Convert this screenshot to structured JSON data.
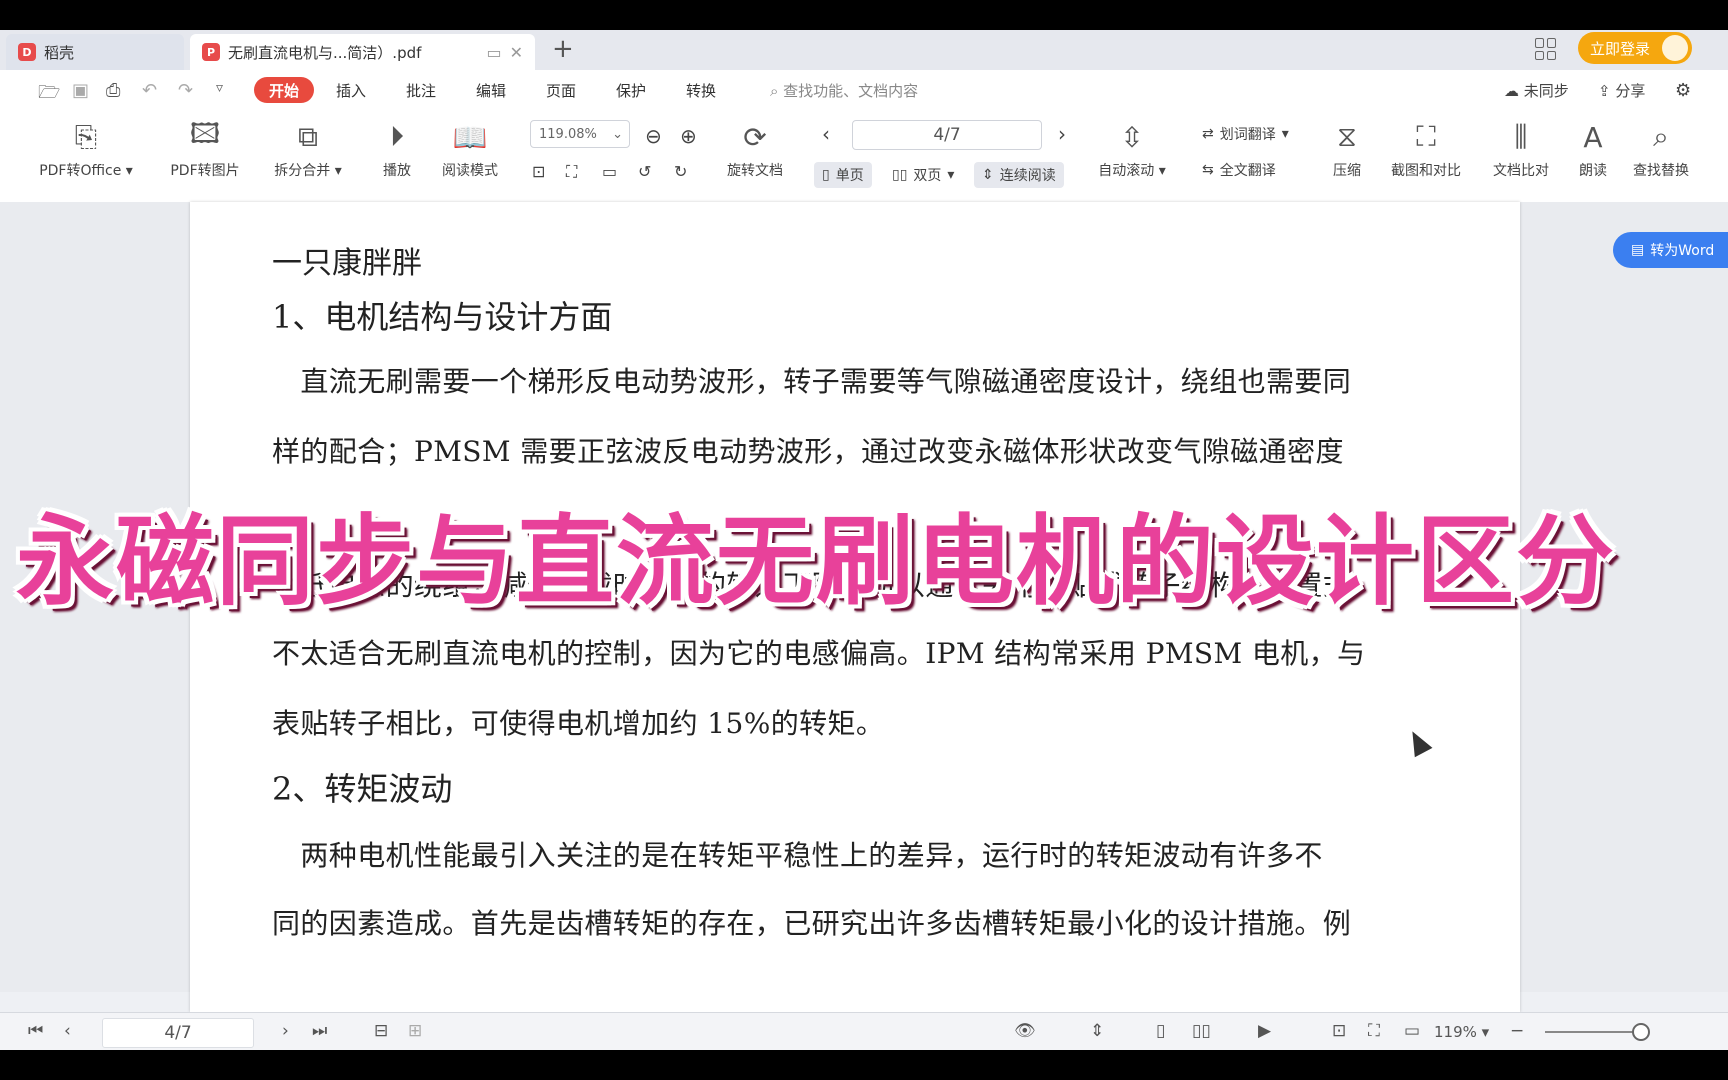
{
  "tabs": [
    {
      "label": "稻壳"
    },
    {
      "label": "无刷直流电机与...简洁）.pdf"
    }
  ],
  "titlebar": {
    "login": "立即登录"
  },
  "menu": {
    "start": "开始",
    "items": [
      "插入",
      "批注",
      "编辑",
      "页面",
      "保护",
      "转换"
    ],
    "search_placeholder": "查找功能、文档内容",
    "sync": "未同步",
    "share": "分享"
  },
  "ribbon": {
    "pdf_office": "PDF转Office",
    "pdf_image": "PDF转图片",
    "split_merge": "拆分合并",
    "play": "播放",
    "read_mode": "阅读模式",
    "zoom": "119.08%",
    "rotate": "旋转文档",
    "page_value": "4/7",
    "single": "单页",
    "double": "双页",
    "continuous": "连续阅读",
    "auto_scroll": "自动滚动",
    "word_translate": "划词翻译",
    "full_translate": "全文翻译",
    "compress": "压缩",
    "screenshot_compare": "截图和对比",
    "doc_compare": "文档比对",
    "read_aloud": "朗读",
    "find_replace": "查找替换"
  },
  "convert_word": "转为Word",
  "document": {
    "author": "一只康胖胖",
    "heading1": "1、电机结构与设计方面",
    "para1": [
      "　直流无刷需要一个梯形反电动势波形，转子需要等气隙磁通密度设计，绕组也需要同",
      "样的配合；PMSM 需要正弦波反电动势波形，通过改变永磁体形状改变气隙磁通密度",
      "个低电感的绕组，减低负载时引起的转速下降，所以通常采用表贴式转子结构。内置式",
      "不太适合无刷直流电机的控制，因为它的电感偏高。IPM 结构常采用 PMSM 电机，与",
      "表贴转子相比，可使得电机增加约 15%的转矩。"
    ],
    "heading2": "2、转矩波动",
    "para2": [
      "　两种电机性能最引入关注的是在转矩平稳性上的差异，运行时的转矩波动有许多不",
      "同的因素造成。首先是齿槽转矩的存在，已研究出许多齿槽转矩最小化的设计措施。例"
    ]
  },
  "overlay_title": "永磁同步与直流无刷电机的设计区分",
  "statusbar": {
    "page": "4/7",
    "zoom": "119%"
  }
}
